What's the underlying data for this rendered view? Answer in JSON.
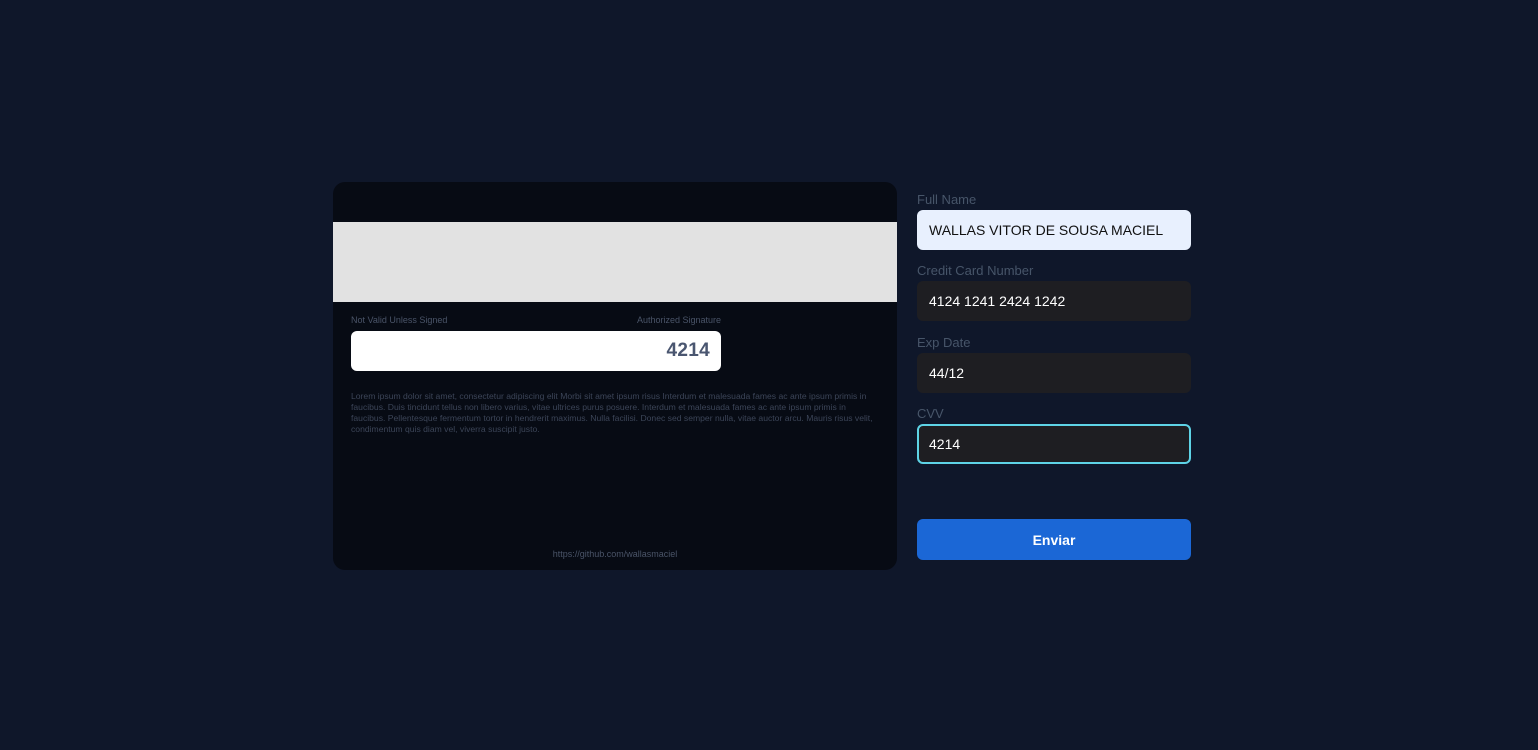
{
  "card_back": {
    "signature_left_label": "Not Valid Unless Signed",
    "signature_right_label": "Authorized Signature",
    "cvv": "4214",
    "legal_text": "Lorem ipsum dolor sit amet, consectetur adipiscing elit Morbi sit amet ipsum risus Interdum et malesuada fames ac ante ipsum primis in faucibus. Duis tincidunt tellus non libero varius, vitae ultrices purus posuere. Interdum et malesuada fames ac ante ipsum primis in faucibus. Pellentesque fermentum tortor in hendrerit maximus. Nulla facilisi. Donec sed semper nulla, vitae auctor arcu. Mauris risus velit, condimentum quis diam vel, viverra suscipit justo.",
    "footer_link": "https://github.com/wallasmaciel"
  },
  "form": {
    "full_name": {
      "label": "Full Name",
      "value": "WALLAS VITOR DE SOUSA MACIEL"
    },
    "card_number": {
      "label": "Credit Card Number",
      "value": "4124 1241 2424 1242"
    },
    "exp_date": {
      "label": "Exp Date",
      "value": "44/12"
    },
    "cvv": {
      "label": "CVV",
      "value": "4214"
    },
    "submit_label": "Enviar"
  },
  "colors": {
    "background": "#0f172a",
    "card": "#070b14",
    "accent_button": "#1b67d6",
    "focus_border": "#5ed3e6"
  }
}
